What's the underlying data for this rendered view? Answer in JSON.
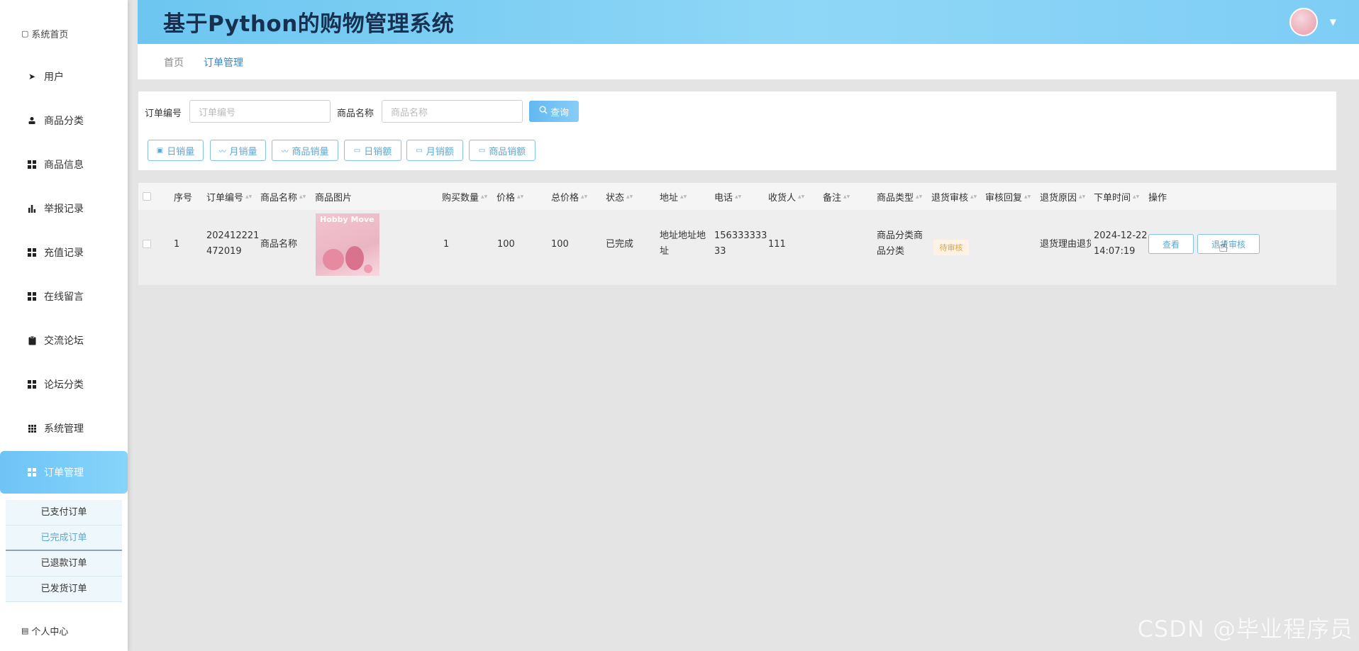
{
  "app": {
    "title": "基于Python的购物管理系统"
  },
  "sidebar": {
    "top_label": "系统首页",
    "items": [
      {
        "label": "用户",
        "icon": "send-icon"
      },
      {
        "label": "商品分类",
        "icon": "user-icon"
      },
      {
        "label": "商品信息",
        "icon": "grid-icon"
      },
      {
        "label": "举报记录",
        "icon": "bar-chart-icon"
      },
      {
        "label": "充值记录",
        "icon": "grid-icon"
      },
      {
        "label": "在线留言",
        "icon": "grid-icon"
      },
      {
        "label": "交流论坛",
        "icon": "clipboard-icon"
      },
      {
        "label": "论坛分类",
        "icon": "grid-icon"
      },
      {
        "label": "系统管理",
        "icon": "grid9-icon"
      },
      {
        "label": "订单管理",
        "icon": "grid-icon"
      }
    ],
    "submenu": [
      "已支付订单",
      "已完成订单",
      "已退款订单",
      "已发货订单"
    ],
    "bottom_label": "个人中心"
  },
  "breadcrumb": {
    "home": "首页",
    "current": "订单管理"
  },
  "filter": {
    "order_no_label": "订单编号",
    "order_no_placeholder": "订单编号",
    "product_name_label": "商品名称",
    "product_name_placeholder": "商品名称",
    "search_button": "查询"
  },
  "toolbar": [
    "日销量",
    "月销量",
    "商品销量",
    "日销额",
    "月销额",
    "商品销额"
  ],
  "table": {
    "headers": [
      "序号",
      "订单编号",
      "商品名称",
      "商品图片",
      "购买数量",
      "价格",
      "总价格",
      "状态",
      "地址",
      "电话",
      "收货人",
      "备注",
      "商品类型",
      "退货审核",
      "审核回复",
      "退货原因",
      "下单时间",
      "操作"
    ],
    "row": {
      "index": "1",
      "order_no_1": "202412221",
      "order_no_2": "472019",
      "product_name": "商品名称",
      "image_text": "Hobby Move",
      "quantity": "1",
      "price": "100",
      "total": "100",
      "status": "已完成",
      "address_1": "地址地址地",
      "address_2": "址",
      "phone_1": "156333333",
      "phone_2": "33",
      "receiver": "111",
      "remark": "",
      "type_1": "商品分类商",
      "type_2": "品分类",
      "return_review": "待审核",
      "review_reply": "",
      "return_reason": "退货理由退货",
      "time_1": "2024-12-22",
      "time_2": "14:07:19"
    },
    "actions": [
      "查看",
      "退货审核"
    ]
  },
  "watermark": "CSDN @毕业程序员",
  "colors": {
    "accent": "#6ec4f6",
    "header_text": "#173050",
    "link": "#5aa8d6",
    "badge": "#e6a23c"
  }
}
